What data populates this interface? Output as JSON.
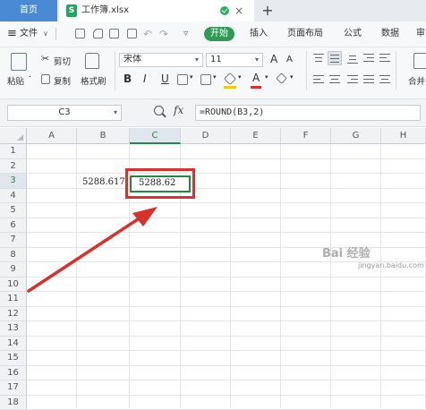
{
  "tabs": {
    "home": "首页",
    "file": "工作簿.xlsx",
    "file_icon": "S",
    "close": "×",
    "new": "+"
  },
  "menu": {
    "hamburger": "≡",
    "file": "文件",
    "file_caret": "∨",
    "undo": "↶",
    "redo": "↷",
    "more_caret": "▿",
    "start": "开始",
    "insert": "插入",
    "page_layout": "页面布局",
    "formula": "公式",
    "data": "数据",
    "review_partial": "审"
  },
  "ribbon": {
    "paste": "粘贴",
    "paste_caret": "·",
    "cut": "剪切",
    "copy": "复制",
    "format_painter": "格式刷",
    "font_name": "宋体",
    "font_size": "11",
    "grow_font": "A",
    "shrink_font": "A",
    "bold": "B",
    "italic": "I",
    "underline": "U",
    "font_color_letter": "A",
    "merge_partial": "合并",
    "dropdown_caret": "▾"
  },
  "formula_bar": {
    "name_box": "C3",
    "fx": "fx",
    "formula": "=ROUND(B3,2)"
  },
  "columns": [
    "A",
    "B",
    "C",
    "D",
    "E",
    "F",
    "G",
    "H"
  ],
  "rows": [
    "1",
    "2",
    "3",
    "4",
    "5",
    "6",
    "7",
    "8",
    "9",
    "10",
    "11",
    "12",
    "13",
    "14",
    "15",
    "16",
    "17",
    "18"
  ],
  "active_cell": "C3",
  "cells": {
    "B3": "5288.617",
    "C3": "5288.62"
  },
  "watermark": {
    "text": "Bai  经验",
    "sub": "jingyan.baidu.com"
  },
  "colors": {
    "accent_green": "#2e9a56",
    "highlight_red": "#d9312b",
    "tab_blue": "#4a8ad4"
  }
}
